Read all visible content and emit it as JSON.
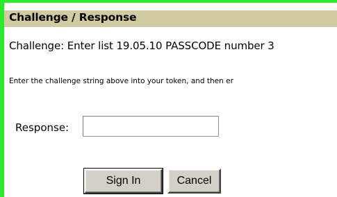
{
  "header": {
    "title": "Challenge / Response"
  },
  "challenge": {
    "text": "Challenge: Enter list 19.05.10 PASSCODE number 3"
  },
  "instruction": {
    "text": "Enter the challenge string above into your token, and then er"
  },
  "form": {
    "response_label": "Response:",
    "response_value": ""
  },
  "buttons": {
    "sign_in_label": "Sign In",
    "cancel_label": "Cancel"
  },
  "colors": {
    "frame_border": "#2bea2b",
    "header_background": "#d0cca0",
    "button_face": "#d4d0c8"
  }
}
